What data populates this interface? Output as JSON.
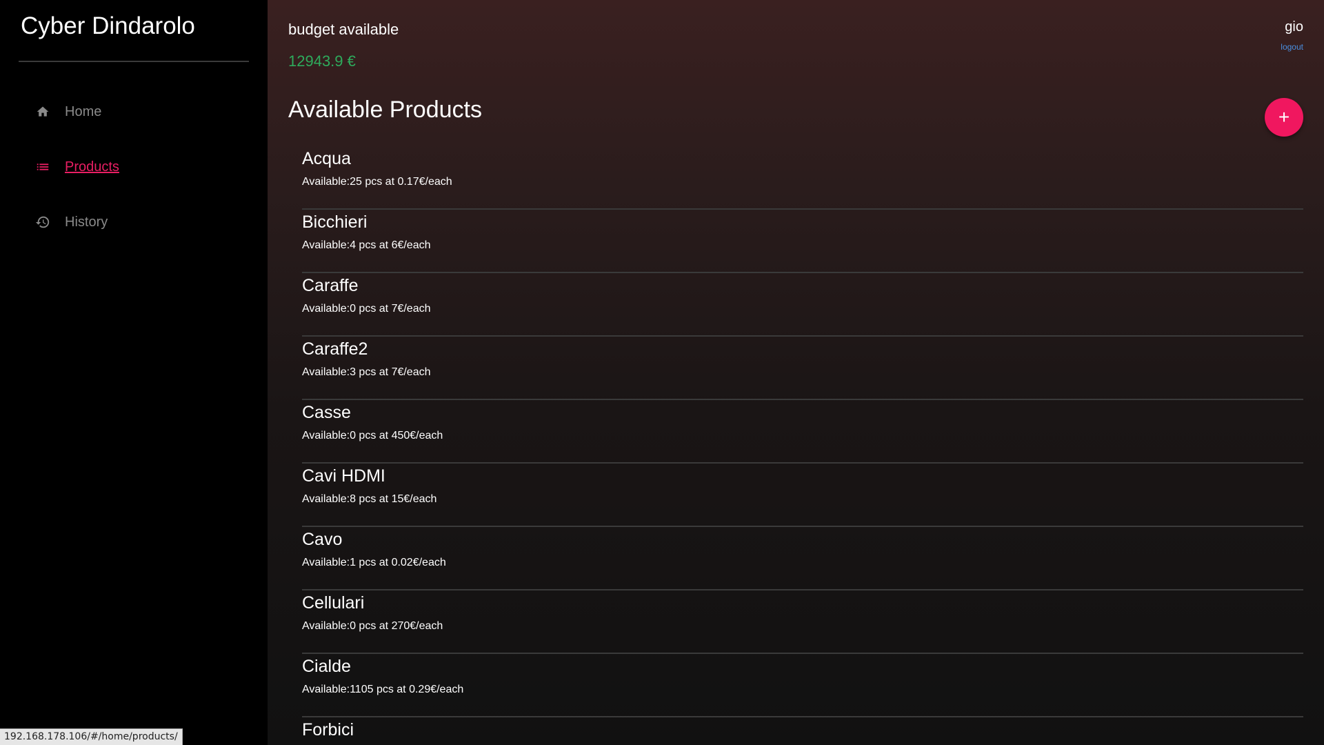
{
  "app": {
    "brand": "Cyber Dindarolo"
  },
  "sidebar": {
    "items": [
      {
        "label": "Home",
        "icon": "home-icon",
        "active": false
      },
      {
        "label": "Products",
        "icon": "list-icon",
        "active": true
      },
      {
        "label": "History",
        "icon": "history-icon",
        "active": false
      }
    ]
  },
  "header": {
    "budget_label": "budget available",
    "budget_value": "12943.9 €",
    "user_name": "gio",
    "logout_label": "logout"
  },
  "main": {
    "title": "Available Products",
    "add_button_label": "+"
  },
  "products": [
    {
      "name": "Acqua",
      "info": "Available:25 pcs at 0.17€/each"
    },
    {
      "name": "Bicchieri",
      "info": "Available:4 pcs at 6€/each"
    },
    {
      "name": "Caraffe",
      "info": "Available:0 pcs at 7€/each"
    },
    {
      "name": "Caraffe2",
      "info": "Available:3 pcs at 7€/each"
    },
    {
      "name": "Casse",
      "info": "Available:0 pcs at 450€/each"
    },
    {
      "name": "Cavi HDMI",
      "info": "Available:8 pcs at 15€/each"
    },
    {
      "name": "Cavo",
      "info": "Available:1 pcs at 0.02€/each"
    },
    {
      "name": "Cellulari",
      "info": "Available:0 pcs at 270€/each"
    },
    {
      "name": "Cialde",
      "info": "Available:1105 pcs at 0.29€/each"
    },
    {
      "name": "Forbici",
      "info": ""
    }
  ],
  "status_bar": {
    "url": "192.168.178.106/#/home/products/"
  },
  "colors": {
    "accent": "#e91e63",
    "fab": "#f0175f",
    "budget": "#2eab5c",
    "link": "#4a8fe0"
  }
}
